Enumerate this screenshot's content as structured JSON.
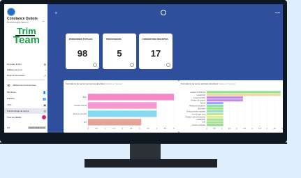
{
  "user": {
    "name": "Constance Dubois",
    "email": "constance@trimteam.fr"
  },
  "logo": {
    "line1": "Trim",
    "line2": "Team"
  },
  "sidebar": {
    "items_top": [
      {
        "label": "Nouveau fichier",
        "icon": "⊞"
      },
      {
        "label": "Tableau de bord",
        "icon": "◔"
      },
      {
        "label": "Notes d'information",
        "icon": "↗"
      }
    ],
    "section_title": "Tableau de bord services",
    "items_main": [
      {
        "label": "Membres",
        "icon": "👤"
      },
      {
        "label": "Equipes",
        "icon": "👥"
      },
      {
        "label": "Jobs",
        "icon": "▣"
      },
      {
        "label": "Fonctionnage de temps",
        "icon": "☰"
      },
      {
        "label": "Tous les détails",
        "icon": ""
      }
    ],
    "footer": {
      "lang": "FR",
      "button": "DECONNEXION"
    }
  },
  "topbar": {
    "right_label": "Profil"
  },
  "kpis": [
    {
      "title": "PERSONNES TOTALES",
      "value": "98"
    },
    {
      "title": "PROFESSIONS",
      "value": "5"
    },
    {
      "title": "FORMATIONS INSCRITES",
      "value": "17"
    }
  ],
  "charts_text": {
    "left_title": "Formations de temps personnes abordées",
    "left_sub": "(durée en heures)",
    "right_title": "Formations de temps activités abordées",
    "right_sub": "(durée en heures)"
  },
  "colors": {
    "screen": "#2f4f9d",
    "accent": "#18a14a"
  },
  "chart_data": [
    {
      "type": "bar",
      "orientation": "horizontal",
      "categories": [
        "Bien",
        "Gestion interne",
        "Santé et sécurité",
        "IUT"
      ],
      "values": [
        5.0,
        4.0,
        4.0,
        3.1
      ],
      "colors": [
        "#f28ac7",
        "#f49ad0",
        "#8ad9f2",
        "#e4a597"
      ],
      "xlim": [
        0,
        5
      ],
      "xticks": [
        "0",
        "0.5",
        "1",
        "1.5",
        "2",
        "2.5",
        "3",
        "3.5",
        "4",
        "4.5",
        "5"
      ]
    },
    {
      "type": "bar",
      "orientation": "horizontal",
      "categories": [
        "Gestion COVID-19",
        "Leadership",
        "Impact durable",
        "Gestion de projets",
        "Travail",
        "Relations humaines",
        "Bien-être",
        "Environnement durable",
        "Vivre et agir hors",
        "Relation client/entreprise",
        "Leadership",
        "IUT",
        "Gestion d'équipe"
      ],
      "values": [
        4.9,
        4.9,
        2.4,
        2.4,
        1.1,
        1.1,
        1.1,
        1.1,
        1.1,
        1.1,
        1.1,
        1.1,
        1.1
      ],
      "colors": [
        "#8fe08f",
        "#eed79a",
        "#b987e6",
        "#c38be8",
        "#a6a6f0",
        "#8fe0b0",
        "#a4e48a",
        "#9fd8c9",
        "#bfe39c",
        "#e8e89a",
        "#9fe09f",
        "#b2dd94",
        "#96d89a"
      ],
      "xlim": [
        0,
        5
      ],
      "xticks": [
        "0",
        "0.5",
        "1",
        "1.5",
        "2",
        "2.5",
        "3",
        "3.5",
        "4",
        "4.5",
        "5"
      ]
    }
  ]
}
